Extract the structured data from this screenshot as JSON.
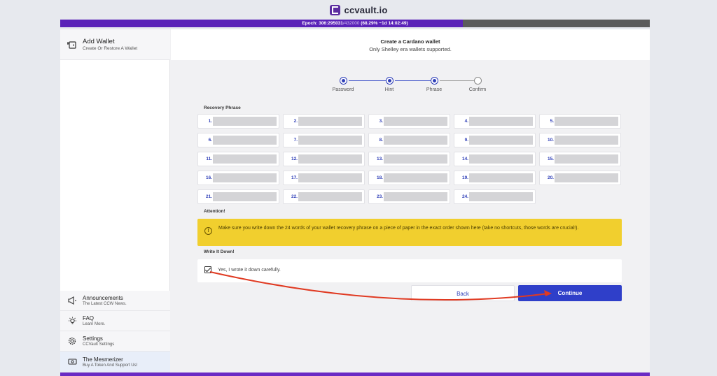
{
  "brand": {
    "name": "ccvault.io",
    "logo_color": "#5b2ca0"
  },
  "epoch": {
    "label": "Epoch: 306",
    "slot": ":295031",
    "total": "/432000",
    "progress_text": "(68.29% ~1d 14:02:49)",
    "progress_percent": 68.29,
    "fill_color": "#5a22b8"
  },
  "sidebar": {
    "top_item": {
      "title": "Add Wallet",
      "subtitle": "Create Or Restore A Wallet",
      "icon": "wallet-add-icon"
    },
    "items": [
      {
        "title": "Announcements",
        "subtitle": "The Latest CCW News.",
        "icon": "megaphone-icon"
      },
      {
        "title": "FAQ",
        "subtitle": "Learn More.",
        "icon": "lightbulb-icon"
      },
      {
        "title": "Settings",
        "subtitle": "CCVault Settings",
        "icon": "gear-icon"
      },
      {
        "title": "The Mesmerizer",
        "subtitle": "Buy A Token And Support Us!",
        "icon": "money-icon"
      }
    ]
  },
  "main": {
    "title": "Create a Cardano wallet",
    "subtitle": "Only Shelley era wallets supported.",
    "steps": [
      {
        "label": "Password",
        "state": "done"
      },
      {
        "label": "Hint",
        "state": "done"
      },
      {
        "label": "Phrase",
        "state": "current"
      },
      {
        "label": "Confirm",
        "state": "todo"
      }
    ],
    "recovery_label": "Recovery Phrase",
    "words": [
      "1.",
      "2.",
      "3.",
      "4.",
      "5.",
      "6.",
      "7.",
      "8.",
      "9.",
      "10.",
      "11.",
      "12.",
      "13.",
      "14.",
      "15.",
      "16.",
      "17.",
      "18.",
      "19.",
      "20.",
      "21.",
      "22.",
      "23.",
      "24."
    ],
    "attention_label": "Attention!",
    "attention_text": "Make sure you write down the 24 words of your wallet recovery phrase on a piece of paper in the exact order shown here (take no shortcuts, those words are crucial!).",
    "write_label": "Write It Down!",
    "checkbox_label": "Yes, I wrote it down carefully.",
    "checkbox_checked": true,
    "back_label": "Back",
    "continue_label": "Continue",
    "accent_color": "#2f3fc9",
    "alert_color": "#f1cf2e"
  }
}
